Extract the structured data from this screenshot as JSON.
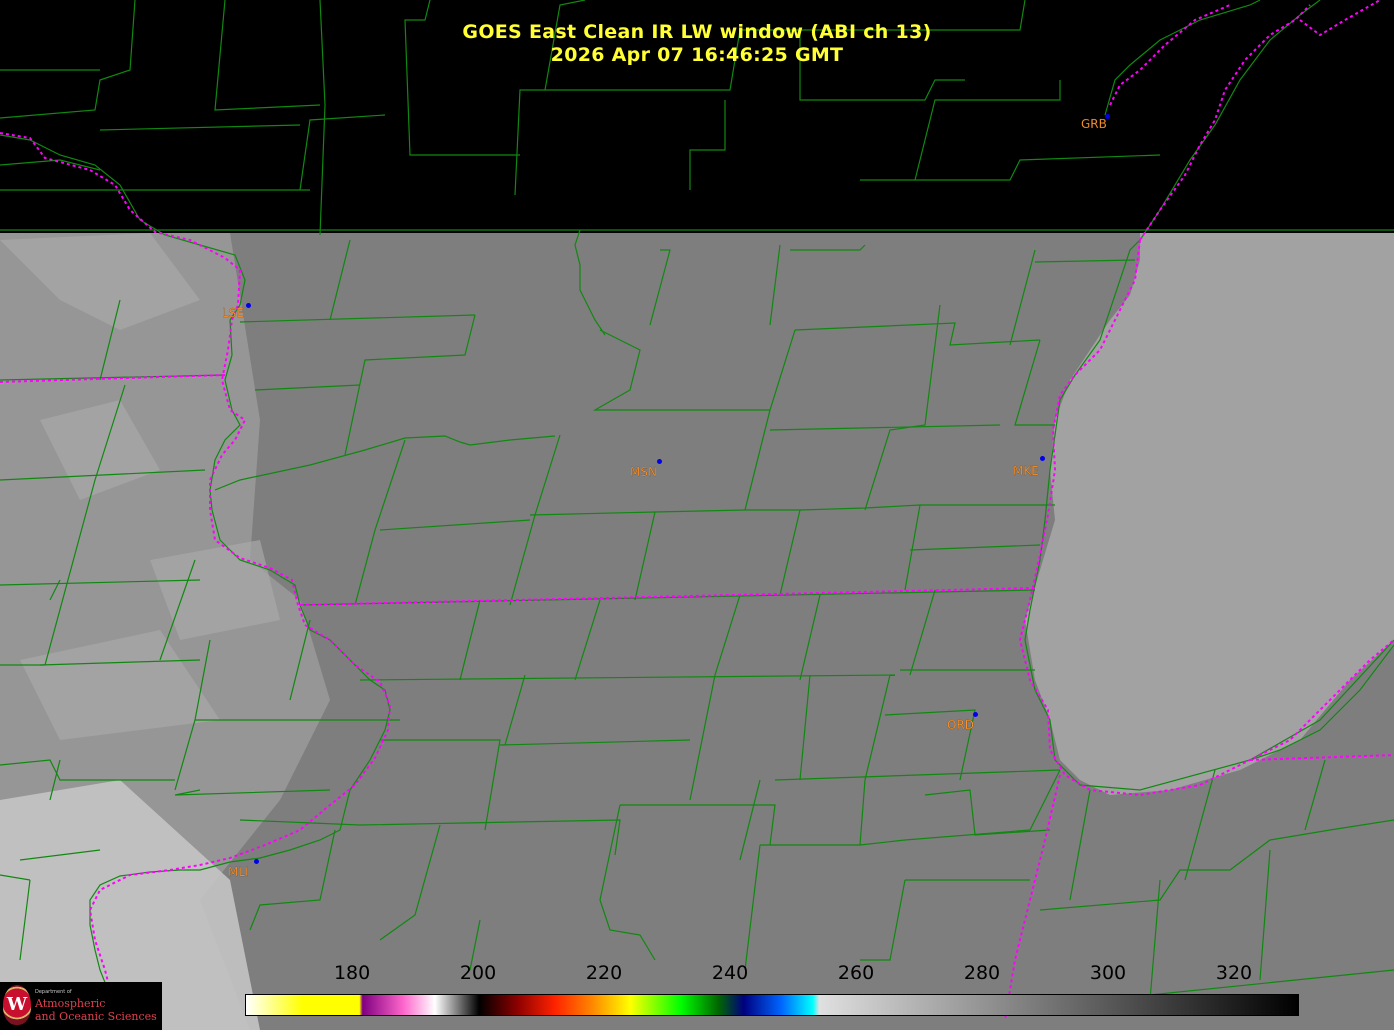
{
  "title": {
    "line1": "GOES East Clean IR LW window (ABI ch 13)",
    "line2": "2026 Apr 07  16:46:25 GMT"
  },
  "stations": [
    {
      "id": "GRB",
      "name_key": "grb"
    },
    {
      "id": "LSE",
      "name_key": "lse"
    },
    {
      "id": "MSN",
      "name_key": "msn"
    },
    {
      "id": "MKE",
      "name_key": "mke"
    },
    {
      "id": "ORD",
      "name_key": "ord"
    },
    {
      "id": "MLI",
      "name_key": "mli"
    }
  ],
  "colorbar": {
    "ticks": [
      "180",
      "200",
      "220",
      "240",
      "260",
      "280",
      "300",
      "320"
    ],
    "stops": [
      {
        "value": 163,
        "color": "#ffffff"
      },
      {
        "value": 172,
        "color": "#ffff00"
      },
      {
        "value": 181,
        "color": "#ffff00"
      },
      {
        "value": 181.5,
        "color": "#800080"
      },
      {
        "value": 188,
        "color": "#ff66cc"
      },
      {
        "value": 193,
        "color": "#ffffff"
      },
      {
        "value": 200,
        "color": "#000000"
      },
      {
        "value": 206,
        "color": "#8b0000"
      },
      {
        "value": 212,
        "color": "#ff2200"
      },
      {
        "value": 218,
        "color": "#ff8800"
      },
      {
        "value": 224,
        "color": "#ffff00"
      },
      {
        "value": 232,
        "color": "#00ff00"
      },
      {
        "value": 238,
        "color": "#006600"
      },
      {
        "value": 242,
        "color": "#000080"
      },
      {
        "value": 248,
        "color": "#0066ff"
      },
      {
        "value": 253,
        "color": "#00ffff"
      },
      {
        "value": 254,
        "color": "#e0e0e0"
      },
      {
        "value": 330,
        "color": "#000000"
      }
    ]
  },
  "logo": {
    "small": "Department of",
    "line1": "Atmospheric",
    "line2": "and Oceanic Sciences"
  },
  "colors": {
    "county_lines": "#118811",
    "state_lines": "#ff00ff",
    "title": "#ffff33",
    "station_label": "#ff9933",
    "station_dot": "#0000ee"
  }
}
